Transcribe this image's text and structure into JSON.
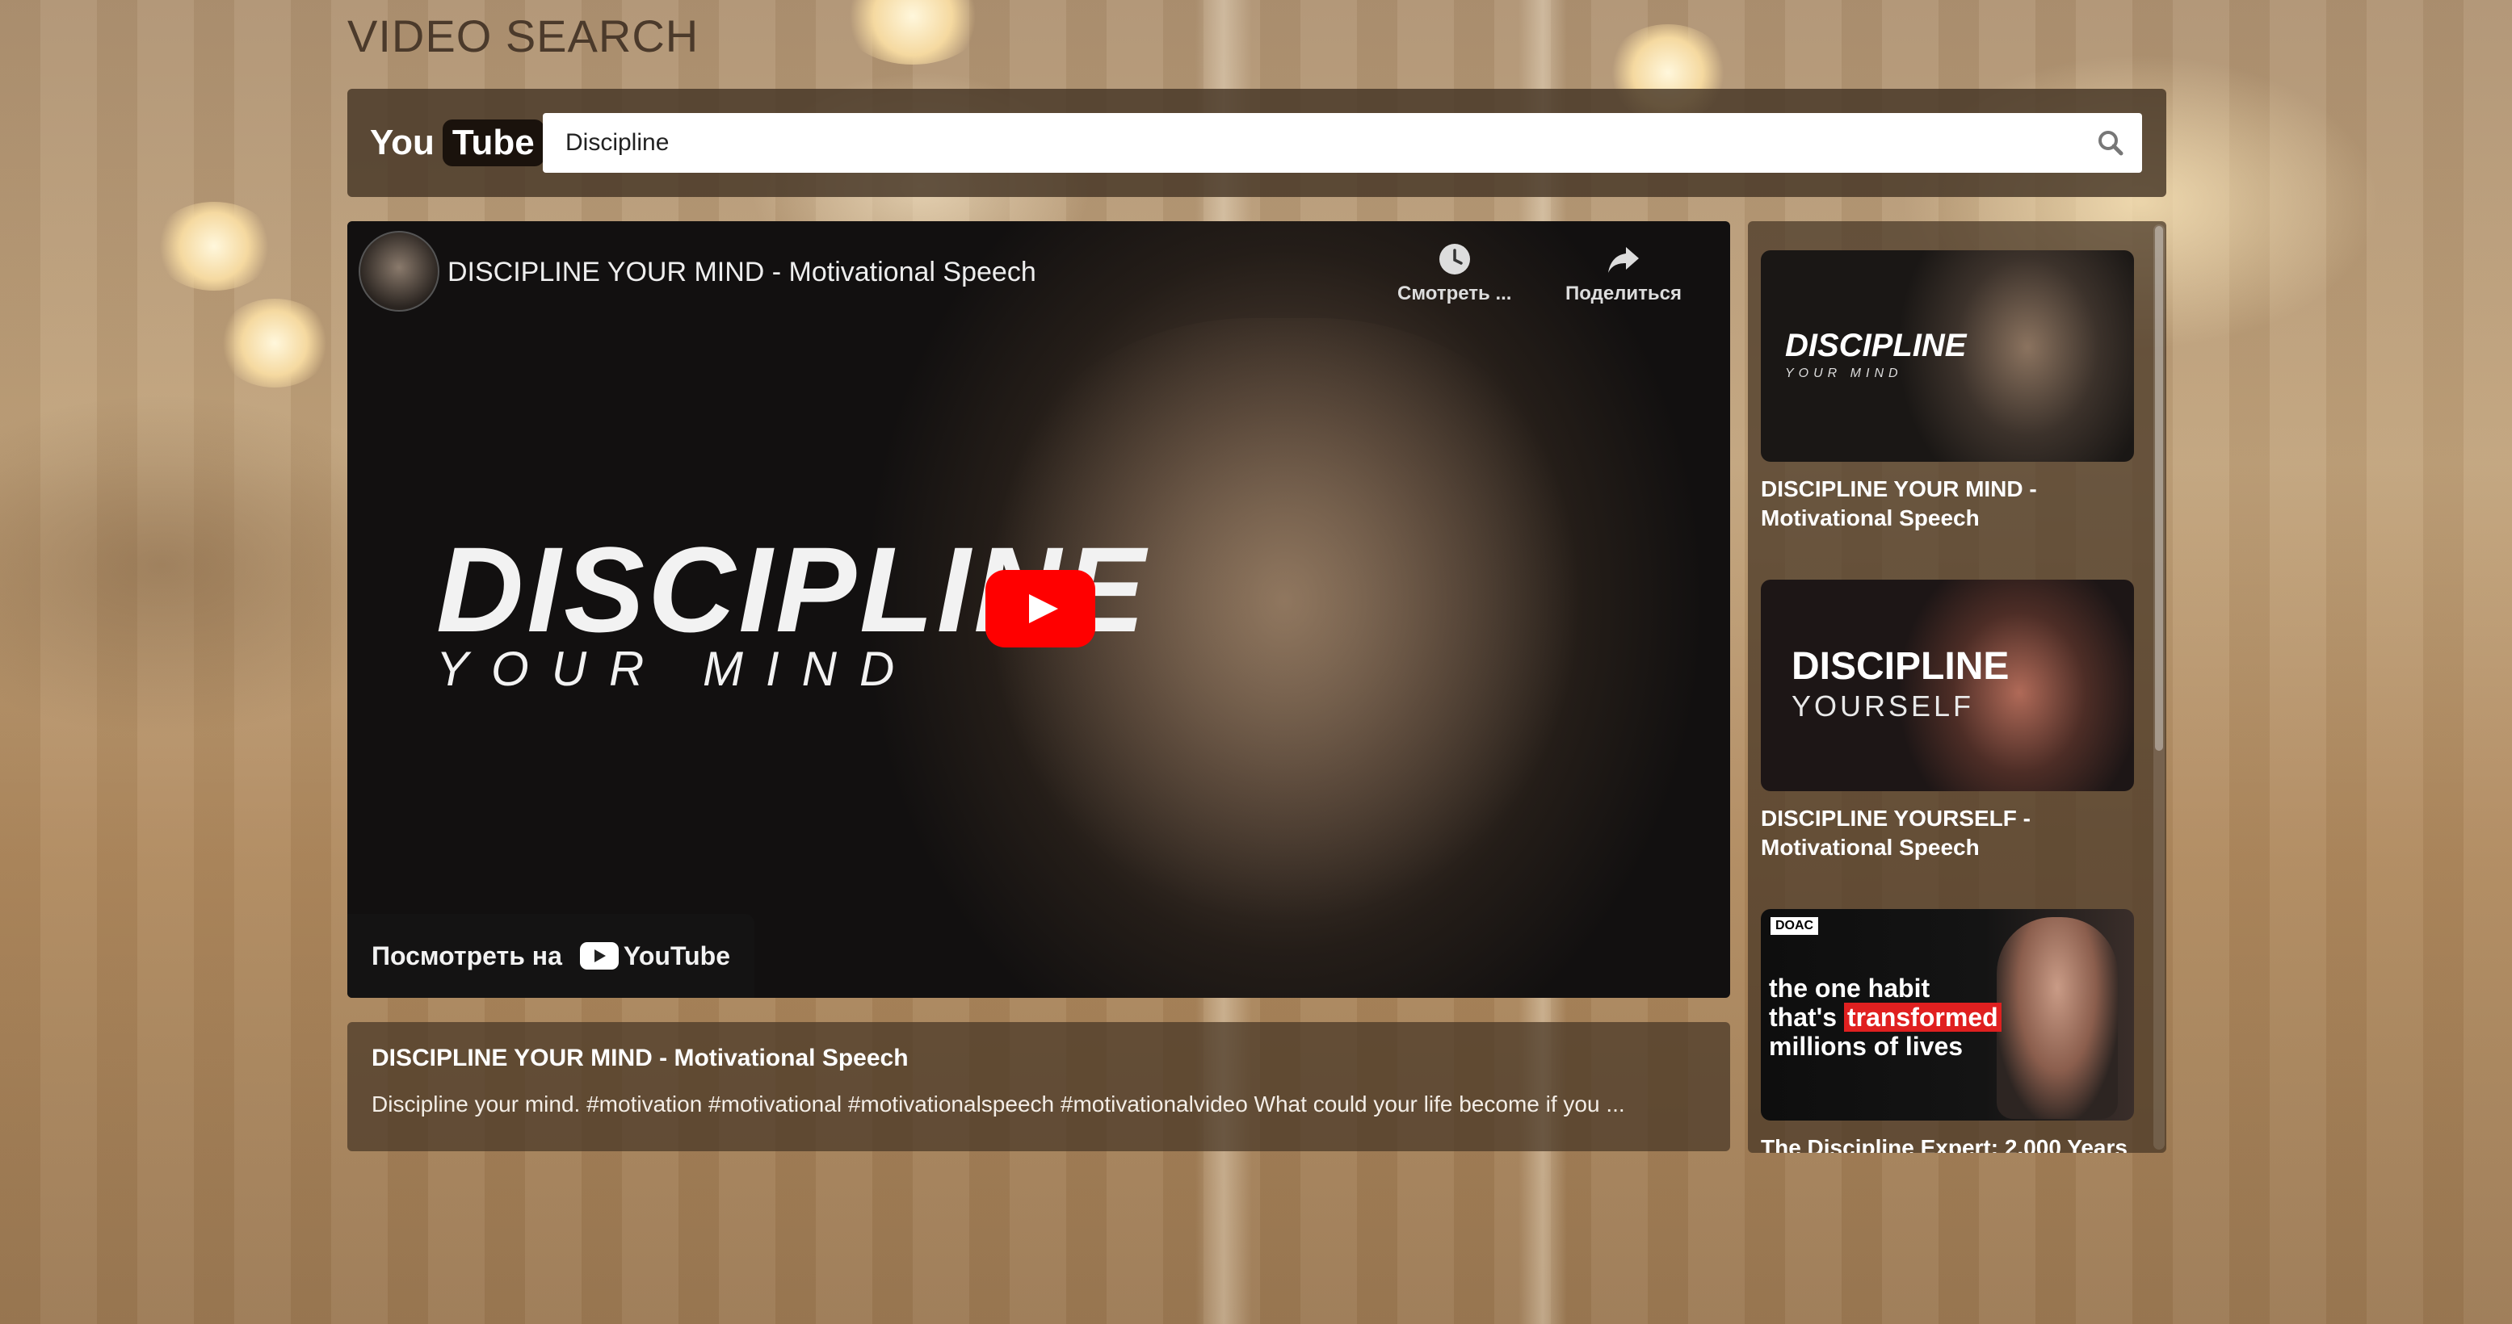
{
  "app": {
    "title": "VIDEO SEARCH"
  },
  "search": {
    "logo_you": "You",
    "logo_tube": "Tube",
    "query": "Discipline",
    "button_icon": "search-icon"
  },
  "player": {
    "channel_icon": "channel-avatar",
    "title": "DISCIPLINE YOUR MIND - Motivational Speech",
    "watch_later_label": "Смотреть ...",
    "share_label": "Поделиться",
    "thumbnail_text_main": "DISCIPLINE",
    "thumbnail_text_sub": "YOUR MIND",
    "watch_on_label": "Посмотреть на",
    "watch_on_brand": "YouTube"
  },
  "selected_video": {
    "title": "DISCIPLINE YOUR MIND - Motivational Speech",
    "description": "Discipline your mind. #motivation #motivational #motivationalspeech #motivationalvideo What could your life become if you ..."
  },
  "results": [
    {
      "title": "DISCIPLINE YOUR MIND - Motivational Speech",
      "thumb_main": "DISCIPLINE",
      "thumb_sub": "YOUR MIND"
    },
    {
      "title": "DISCIPLINE YOURSELF - Motivational Speech",
      "thumb_main": "DISCIPLINE",
      "thumb_sub": "YOURSELF"
    },
    {
      "title": "The Discipline Expert: 2,000 Years",
      "thumb_badge": "DOAC",
      "thumb_line1": "the one habit",
      "thumb_line2_pre": "that's ",
      "thumb_line2_highlight": "transformed",
      "thumb_line3": "millions of lives"
    }
  ],
  "colors": {
    "accent_red": "#ff0000",
    "panel": "#463626"
  }
}
